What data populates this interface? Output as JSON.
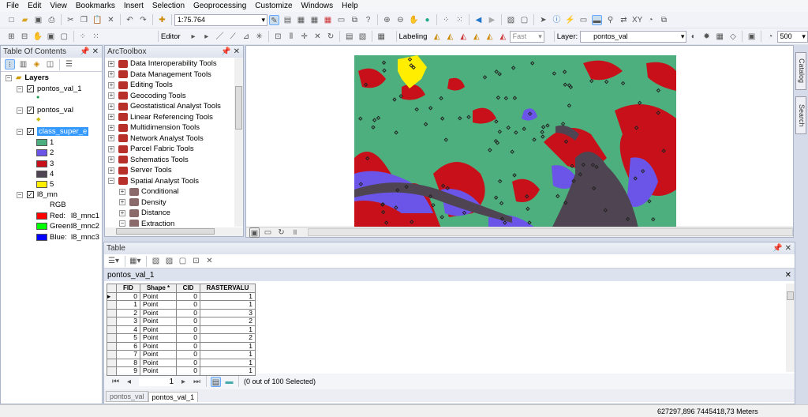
{
  "menu": [
    "File",
    "Edit",
    "View",
    "Bookmarks",
    "Insert",
    "Selection",
    "Geoprocessing",
    "Customize",
    "Windows",
    "Help"
  ],
  "toolbar": {
    "scale": "1:75.764",
    "editor": "Editor",
    "labeling": "Labeling",
    "label_quality": "Fast",
    "layer_label": "Layer:",
    "layer_value": "pontos_val",
    "count": "500"
  },
  "toc": {
    "title": "Table Of Contents",
    "root": "Layers",
    "layers": [
      {
        "name": "pontos_val_1"
      },
      {
        "name": "pontos_val"
      },
      {
        "name": "class_super_e",
        "selected": true
      },
      {
        "name": "l8_mn"
      }
    ],
    "classes": [
      {
        "label": "1",
        "color": "#4caf7d"
      },
      {
        "label": "2",
        "color": "#6a55e8"
      },
      {
        "label": "3",
        "color": "#c8101a"
      },
      {
        "label": "4",
        "color": "#4f4552"
      },
      {
        "label": "5",
        "color": "#ffee00"
      }
    ],
    "rgb_label": "RGB",
    "bands": [
      {
        "label": "Red:",
        "band": "l8_mnc1",
        "color": "#ff0000"
      },
      {
        "label": "Green:",
        "band": "l8_mnc2",
        "color": "#00ff00"
      },
      {
        "label": "Blue:",
        "band": "l8_mnc3",
        "color": "#0000ff"
      }
    ]
  },
  "toolbox": {
    "title": "ArcToolbox",
    "tools": [
      "Data Interoperability Tools",
      "Data Management Tools",
      "Editing Tools",
      "Geocoding Tools",
      "Geostatistical Analyst Tools",
      "Linear Referencing Tools",
      "Multidimension Tools",
      "Network Analyst Tools",
      "Parcel Fabric Tools",
      "Schematics Tools",
      "Server Tools",
      "Spatial Analyst Tools"
    ],
    "subtools": [
      "Conditional",
      "Density",
      "Distance",
      "Extraction"
    ]
  },
  "side_tabs": [
    "Catalog",
    "Search"
  ],
  "table": {
    "title": "Table",
    "layer": "pontos_val_1",
    "columns": [
      "FID",
      "Shape *",
      "CID",
      "RASTERVALU"
    ],
    "rows": [
      [
        "0",
        "Point",
        "0",
        "1"
      ],
      [
        "1",
        "Point",
        "0",
        "1"
      ],
      [
        "2",
        "Point",
        "0",
        "3"
      ],
      [
        "3",
        "Point",
        "0",
        "2"
      ],
      [
        "4",
        "Point",
        "0",
        "1"
      ],
      [
        "5",
        "Point",
        "0",
        "2"
      ],
      [
        "6",
        "Point",
        "0",
        "1"
      ],
      [
        "7",
        "Point",
        "0",
        "1"
      ],
      [
        "8",
        "Point",
        "0",
        "1"
      ],
      [
        "9",
        "Point",
        "0",
        "1"
      ]
    ],
    "page": "1",
    "selection": "(0 out of 100 Selected)",
    "tabs": [
      "pontos_val",
      "pontos_val_1"
    ],
    "active_tab": 1
  },
  "status": {
    "coords": "627297,896  7445418,73 Meters"
  }
}
